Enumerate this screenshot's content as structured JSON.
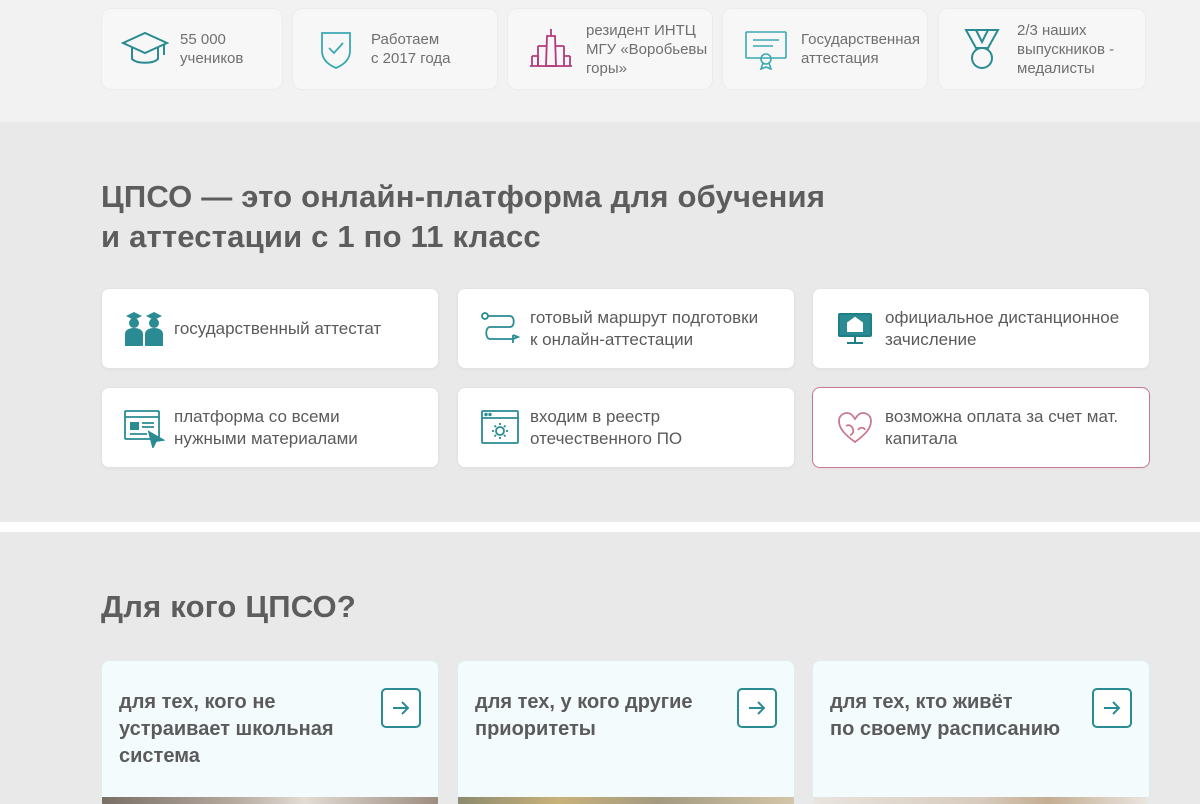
{
  "stats": [
    {
      "icon": "graduation-cap-icon",
      "text": "55 000\nучеников"
    },
    {
      "icon": "shield-check-icon",
      "text": "Работаем\nс 2017 года"
    },
    {
      "icon": "university-building-icon",
      "text": "резидент ИНТЦ\nМГУ «Воробьевы\nгоры»"
    },
    {
      "icon": "certificate-icon",
      "text": "Государственная\nаттестация"
    },
    {
      "icon": "medal-icon",
      "text": "2/3 наших\nвыпускников -\nмедалисты"
    }
  ],
  "platform": {
    "title": "ЦПСО — это онлайн-платформа для обучения\nи аттестации с 1 по 11 класс",
    "features": [
      {
        "icon": "students-icon",
        "text": "государственный аттестат"
      },
      {
        "icon": "route-icon",
        "text": "готовый маршрут подготовки\nк онлайн-аттестации"
      },
      {
        "icon": "monitor-school-icon",
        "text": "официальное дистанционное\nзачисление"
      },
      {
        "icon": "browser-materials-icon",
        "text": "платформа со всеми\nнужными материалами"
      },
      {
        "icon": "browser-gear-icon",
        "text": "входим в реестр\nотечественного ПО"
      },
      {
        "icon": "heart-hands-icon",
        "text": "возможна оплата за счет мат.\nкапитала"
      }
    ]
  },
  "audience": {
    "title": "Для кого ЦПСО?",
    "cards": [
      {
        "text": "для тех, кого не\nустраивает школьная\nсистема"
      },
      {
        "text": "для тех, у кого другие\nприоритеты"
      },
      {
        "text": "для тех, кто живёт\nпо своему расписанию"
      }
    ]
  },
  "colors": {
    "teal": "#2a8b93",
    "magenta": "#b43a7c",
    "pink_border": "#c9798f",
    "heading": "#5d5d5d"
  }
}
